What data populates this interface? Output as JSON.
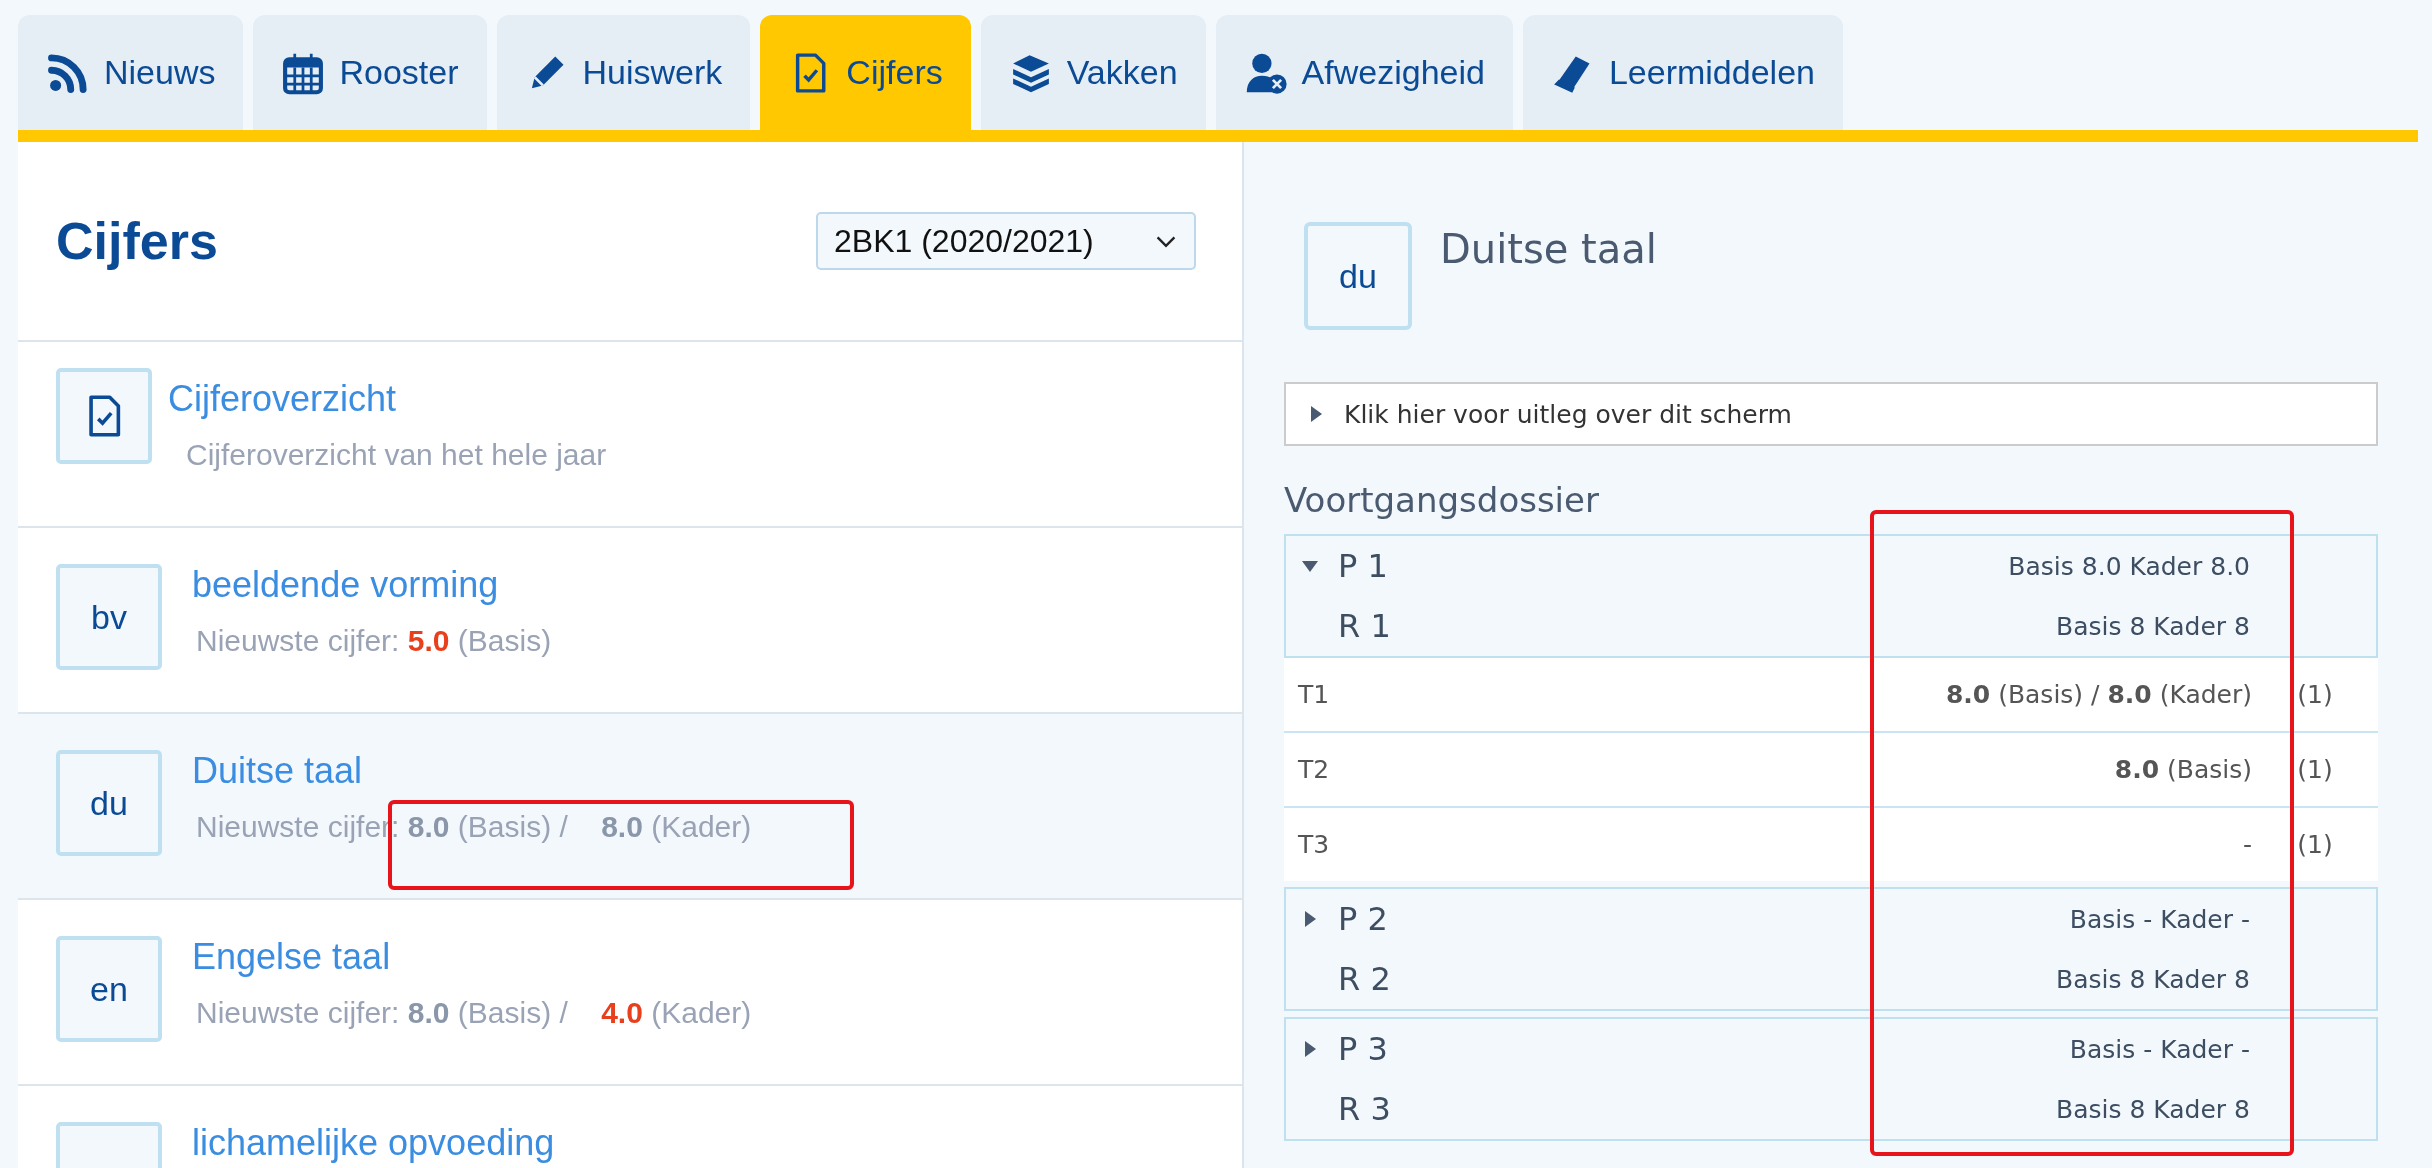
{
  "tabs": [
    {
      "label": "Nieuws",
      "selected": false
    },
    {
      "label": "Rooster",
      "selected": false
    },
    {
      "label": "Huiswerk",
      "selected": false
    },
    {
      "label": "Cijfers",
      "selected": true
    },
    {
      "label": "Vakken",
      "selected": false
    },
    {
      "label": "Afwezigheid",
      "selected": false
    },
    {
      "label": "Leermiddelen",
      "selected": false
    }
  ],
  "grades_list": {
    "title": "Cijfers",
    "period_select": {
      "value": "2BK1 (2020/2021)"
    },
    "items": [
      {
        "kind": "overview",
        "title": "Cijferoverzicht",
        "subtitle": "Cijferoverzicht van het hele jaar",
        "selected": false,
        "highlighted": false
      },
      {
        "kind": "course",
        "badge": "bv",
        "title": "beeldende vorming",
        "label": "Nieuwste cijfer:",
        "grades": [
          {
            "value": "5.0",
            "level": "(Basis)",
            "failing": true
          }
        ],
        "selected": false,
        "highlighted": false
      },
      {
        "kind": "course",
        "badge": "du",
        "title": "Duitse taal",
        "label": "Nieuwste cijfer:",
        "separator": "/",
        "grades": [
          {
            "value": "8.0",
            "level": "(Basis)",
            "failing": false
          },
          {
            "value": "8.0",
            "level": "(Kader)",
            "failing": false
          }
        ],
        "selected": true,
        "highlighted": true
      },
      {
        "kind": "course",
        "badge": "en",
        "title": "Engelse taal",
        "label": "Nieuwste cijfer:",
        "separator": "/",
        "grades": [
          {
            "value": "8.0",
            "level": "(Basis)",
            "failing": false
          },
          {
            "value": "4.0",
            "level": "(Kader)",
            "failing": true
          }
        ],
        "selected": false,
        "highlighted": false
      },
      {
        "kind": "course",
        "title": "lichamelijke opvoeding",
        "selected": false,
        "highlighted": false
      }
    ]
  },
  "detail": {
    "badge": "du",
    "title": "Duitse taal",
    "help": {
      "label": "Klik hier voor uitleg over dit scherm",
      "expanded": false
    },
    "section_title": "Voortgangsdossier",
    "result_column_highlighted": true,
    "periods": [
      {
        "period": "P 1",
        "period_result": "Basis 8.0 Kader 8.0",
        "report": "R 1",
        "report_result": "Basis 8 Kader 8",
        "expanded": true,
        "tests": [
          {
            "name": "T1",
            "result": "**8.0** (Basis) / **8.0** (Kader)",
            "count": "(1)"
          },
          {
            "name": "T2",
            "result": "**8.0** (Basis)",
            "count": "(1)"
          },
          {
            "name": "T3",
            "result": "-",
            "count": "(1)"
          }
        ]
      },
      {
        "period": "P 2",
        "period_result": "Basis - Kader -",
        "report": "R 2",
        "report_result": "Basis 8 Kader 8",
        "expanded": false
      },
      {
        "period": "P 3",
        "period_result": "Basis - Kader -",
        "report": "R 3",
        "report_result": "Basis 8 Kader 8",
        "expanded": false
      }
    ]
  }
}
